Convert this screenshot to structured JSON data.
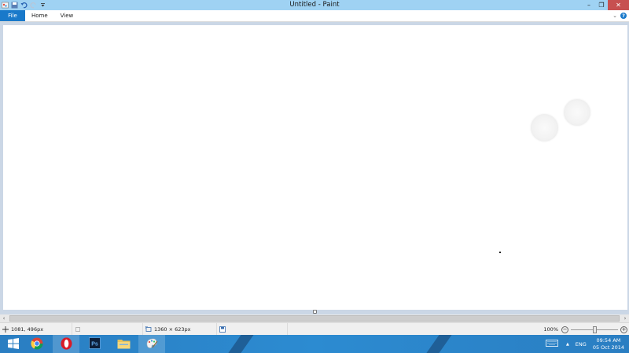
{
  "window": {
    "title": "Untitled - Paint",
    "minimize_glyph": "–",
    "restore_glyph": "❐",
    "close_glyph": "✕"
  },
  "quick_access": {
    "icons": [
      "paint-app-icon",
      "save-icon",
      "undo-icon",
      "redo-icon",
      "customize-dropdown-icon"
    ]
  },
  "ribbon": {
    "tabs": [
      "File",
      "Home",
      "View"
    ],
    "collapse_glyph": "⌄",
    "help_glyph": "?"
  },
  "status": {
    "cursor_position": "1081, 496px",
    "selection_size": "",
    "canvas_size": "1360 × 623px",
    "zoom": "100%",
    "zoom_out_glyph": "−",
    "zoom_in_glyph": "+",
    "zoom_level_fraction": 0.5
  },
  "scrollbar": {
    "left_glyph": "‹",
    "right_glyph": "›"
  },
  "taskbar": {
    "apps": [
      "start-icon",
      "chrome-icon",
      "opera-icon",
      "photoshop-icon",
      "file-explorer-icon",
      "paint-icon"
    ],
    "tray": {
      "keyboard_icon": "keyboard-icon",
      "up_glyph": "▲",
      "language": "ENG",
      "time": "09:54 AM",
      "date": "05 Oct 2014"
    }
  },
  "colors": {
    "titlebar": "#9fd2f3",
    "file_tab": "#1979ca",
    "close_button": "#c75050",
    "workspace": "#cbd7e6",
    "taskbar": "#2c8bd1"
  }
}
